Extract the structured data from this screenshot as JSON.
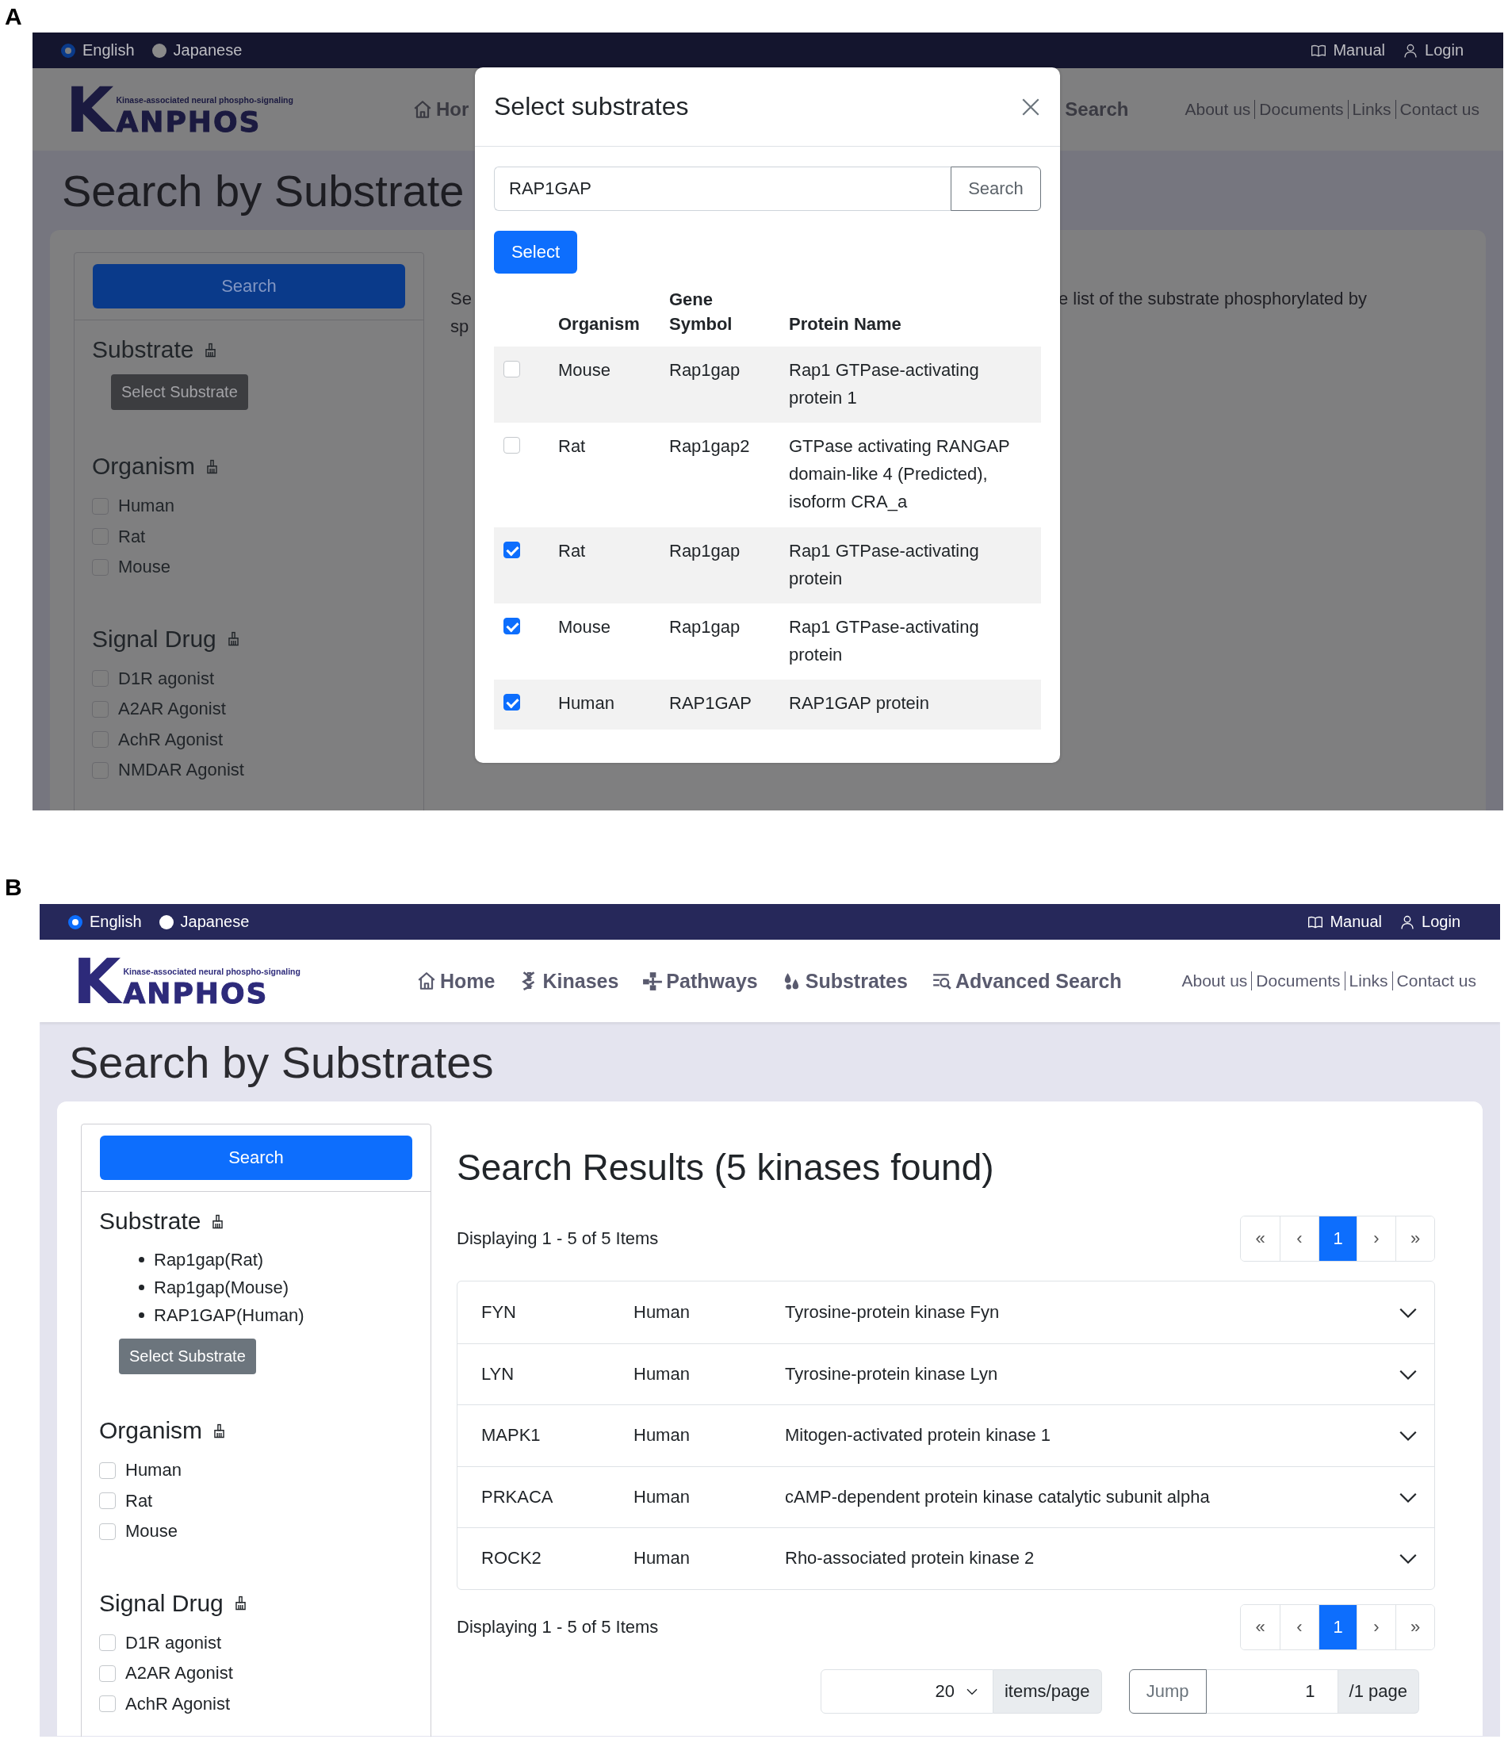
{
  "panel_a": {
    "label": "A",
    "top_bar": {
      "languages": [
        {
          "label": "English",
          "selected": true
        },
        {
          "label": "Japanese",
          "selected": false
        }
      ],
      "links": [
        {
          "label": "Manual",
          "kind": "book"
        },
        {
          "label": "Login",
          "kind": "person"
        }
      ]
    },
    "header": {
      "logo": {
        "tagline": "Kinase-associated neural phospho-signaling",
        "initial": "K",
        "word": "ANPHOS"
      },
      "nav_left": [
        {
          "label": "Hor",
          "kind": "home"
        }
      ],
      "nav_right": [
        {
          "label": "Search"
        }
      ],
      "links": [
        "About us",
        "Documents",
        "Links",
        "Contact us"
      ]
    },
    "page_title": "Search by Substrate",
    "sidebar": {
      "search_button": "Search",
      "sections": [
        {
          "kind": "substrate",
          "title": "Substrate",
          "button": "Select Substrate"
        },
        {
          "kind": "checkboxes",
          "title": "Organism",
          "options": [
            {
              "label": "Human",
              "checked": false
            },
            {
              "label": "Rat",
              "checked": false
            },
            {
              "label": "Mouse",
              "checked": false
            }
          ]
        },
        {
          "kind": "checkboxes",
          "title": "Signal Drug",
          "options": [
            {
              "label": "D1R agonist",
              "checked": false
            },
            {
              "label": "A2AR Agonist",
              "checked": false
            },
            {
              "label": "AchR Agonist",
              "checked": false
            },
            {
              "label": "NMDAR Agonist",
              "checked": false
            }
          ]
        }
      ]
    },
    "main_fragments": {
      "left_lines": [
        "Se",
        "sp"
      ],
      "right_lines": [
        "e list of the substrate phosphorylated by"
      ]
    },
    "modal": {
      "title": "Select substrates",
      "search_value": "RAP1GAP",
      "search_button": "Search",
      "select_button": "Select",
      "columns": [
        "Organism",
        "Gene Symbol",
        "Protein Name"
      ],
      "rows": [
        {
          "checked": false,
          "organism": "Mouse",
          "gene_symbol": "Rap1gap",
          "protein_name": "Rap1 GTPase-activating protein 1"
        },
        {
          "checked": false,
          "organism": "Rat",
          "gene_symbol": "Rap1gap2",
          "protein_name": "GTPase activating RANGAP domain-like 4 (Predicted), isoform CRA_a"
        },
        {
          "checked": true,
          "organism": "Rat",
          "gene_symbol": "Rap1gap",
          "protein_name": "Rap1 GTPase-activating protein"
        },
        {
          "checked": true,
          "organism": "Mouse",
          "gene_symbol": "Rap1gap",
          "protein_name": "Rap1 GTPase-activating protein"
        },
        {
          "checked": true,
          "organism": "Human",
          "gene_symbol": "RAP1GAP",
          "protein_name": "RAP1GAP protein"
        }
      ]
    }
  },
  "panel_b": {
    "label": "B",
    "top_bar": {
      "languages": [
        {
          "label": "English",
          "selected": true
        },
        {
          "label": "Japanese",
          "selected": false
        }
      ],
      "links": [
        {
          "label": "Manual",
          "kind": "book"
        },
        {
          "label": "Login",
          "kind": "person"
        }
      ]
    },
    "header": {
      "logo": {
        "tagline": "Kinase-associated neural phospho-signaling",
        "initial": "K",
        "word": "ANPHOS"
      },
      "nav": [
        {
          "label": "Home",
          "kind": "home"
        },
        {
          "label": "Kinases",
          "kind": "helix"
        },
        {
          "label": "Pathways",
          "kind": "network"
        },
        {
          "label": "Substrates",
          "kind": "drops"
        },
        {
          "label": "Advanced Search",
          "kind": "list-search"
        }
      ],
      "links": [
        "About us",
        "Documents",
        "Links",
        "Contact us"
      ]
    },
    "page_title": "Search by Substrates",
    "sidebar": {
      "search_button": "Search",
      "sections": [
        {
          "kind": "substrate",
          "title": "Substrate",
          "items": [
            "Rap1gap(Rat)",
            "Rap1gap(Mouse)",
            "RAP1GAP(Human)"
          ],
          "button": "Select Substrate"
        },
        {
          "kind": "checkboxes",
          "title": "Organism",
          "options": [
            {
              "label": "Human",
              "checked": false
            },
            {
              "label": "Rat",
              "checked": false
            },
            {
              "label": "Mouse",
              "checked": false
            }
          ]
        },
        {
          "kind": "checkboxes",
          "title": "Signal Drug",
          "options": [
            {
              "label": "D1R agonist",
              "checked": false
            },
            {
              "label": "A2AR Agonist",
              "checked": false
            },
            {
              "label": "AchR Agonist",
              "checked": false
            }
          ]
        }
      ]
    },
    "results": {
      "heading": "Search Results (5 kinases found)",
      "summary_top": "Displaying 1 - 5 of 5 Items",
      "pagination_top": [
        {
          "label": "«",
          "selected": false
        },
        {
          "label": "‹",
          "selected": false
        },
        {
          "label": "1",
          "selected": true
        },
        {
          "label": "›",
          "selected": false
        },
        {
          "label": "»",
          "selected": false
        }
      ],
      "rows": [
        {
          "gene": "FYN",
          "organism": "Human",
          "name": "Tyrosine-protein kinase Fyn",
          "expanded": false
        },
        {
          "gene": "LYN",
          "organism": "Human",
          "name": "Tyrosine-protein kinase Lyn",
          "expanded": false
        },
        {
          "gene": "MAPK1",
          "organism": "Human",
          "name": "Mitogen-activated protein kinase 1",
          "expanded": false
        },
        {
          "gene": "PRKACA",
          "organism": "Human",
          "name": "cAMP-dependent protein kinase catalytic subunit alpha",
          "expanded": false
        },
        {
          "gene": "ROCK2",
          "organism": "Human",
          "name": "Rho-associated protein kinase 2",
          "expanded": false
        }
      ],
      "summary_bottom": "Displaying 1 - 5 of 5 Items",
      "pagination_bottom": [
        {
          "label": "«",
          "selected": false
        },
        {
          "label": "‹",
          "selected": false
        },
        {
          "label": "1",
          "selected": true
        },
        {
          "label": "›",
          "selected": false
        },
        {
          "label": "»",
          "selected": false
        }
      ],
      "page_size": {
        "value": "20",
        "label": "items/page"
      },
      "jump": {
        "button": "Jump",
        "value": "1",
        "suffix": "/1 page"
      }
    }
  }
}
